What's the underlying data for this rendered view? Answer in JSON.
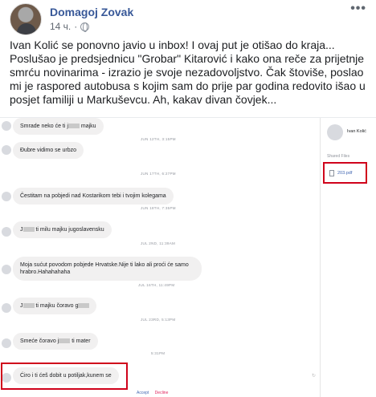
{
  "post": {
    "author": "Domagoj Zovak",
    "time": "14 ч.",
    "separator": "·",
    "text": "Ivan Kolić se ponovno javio u inbox! I ovaj put je otišao do kraja... Poslušao je predsjednicu \"Grobar\" Kitarović i kako ona reče za prijetnje smrću novinarima - izrazio je svoje nezadovoljstvo. Čak štoviše, poslao mi je raspored autobusa s kojim sam do prije par godina redovito išao u posjet familiji u Markuševcu. Ah, kakav divan čovjek...",
    "more_icon": "•••"
  },
  "chat": {
    "messages": [
      {
        "pre": "Smrade neko će ti j",
        "post": " majku"
      },
      {
        "pre": "Đubre vidimo se urbzo",
        "post": ""
      },
      {
        "pre": "Čestitam na pobjedi nad Kostarikom tebi i tvojim kolegama",
        "post": ""
      },
      {
        "pre": "J",
        "post": " ti milu majku jugoslavensku"
      },
      {
        "pre": "Moja sućut povodom pobjede Hrvatske.Nije ti lako ali proći će samo hrabro.Hahahahaha",
        "post": ""
      },
      {
        "pre": "J",
        "post": " ti majku čoravo g"
      },
      {
        "pre": "Smeće čoravo j",
        "post": " ti mater"
      },
      {
        "pre": "Ćiro i ti ćeš dobit u potiljak,kunem se",
        "post": ""
      }
    ],
    "timestamps": [
      "JUN 12TH, 3:15PM",
      "JUN 17TH, 6:27PM",
      "JUN 18TH, 7:35PM",
      "JUL 2ND, 11:39AM",
      "JUL 16TH, 11:49PM",
      "JUL 23RD, 5:13PM",
      "5:31PM"
    ],
    "accept": "Accept",
    "decline": "Decline"
  },
  "sidebar": {
    "name": "Ivan Kolić",
    "shared_files_label": "Shared Files",
    "file_name": "203.pdf"
  },
  "colors": {
    "author": "#385898",
    "highlight": "#d0021b",
    "bubble": "#f1f0f0"
  }
}
